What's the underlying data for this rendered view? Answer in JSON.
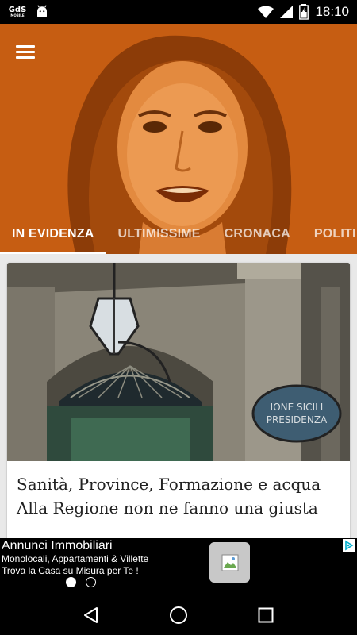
{
  "status_bar": {
    "app_icon_text": "GdS",
    "app_icon_subtext": "MOBILE",
    "time": "18:10"
  },
  "header": {
    "menu_icon": "hamburger-menu-icon",
    "tabs": [
      {
        "label": "IN EVIDENZA",
        "active": true
      },
      {
        "label": "ULTIMISSIME",
        "active": false
      },
      {
        "label": "CRONACA",
        "active": false
      },
      {
        "label": "POLITI",
        "active": false
      }
    ]
  },
  "article": {
    "image_sign": [
      "IONE SICILI",
      "PRESIDENZA"
    ],
    "title_lines": [
      "Sanità, Province, Formazione e acqua",
      "Alla Regione non ne fanno una giusta"
    ]
  },
  "ad": {
    "title": "Annunci Immobiliari",
    "line1": "Monolocali, Appartamenti & Villette",
    "line2": "Trova la Casa su Misura per Te !",
    "pages": 2,
    "current_page": 1
  },
  "colors": {
    "header_orange": "#c65d12",
    "content_bg": "#e9e9e9"
  }
}
